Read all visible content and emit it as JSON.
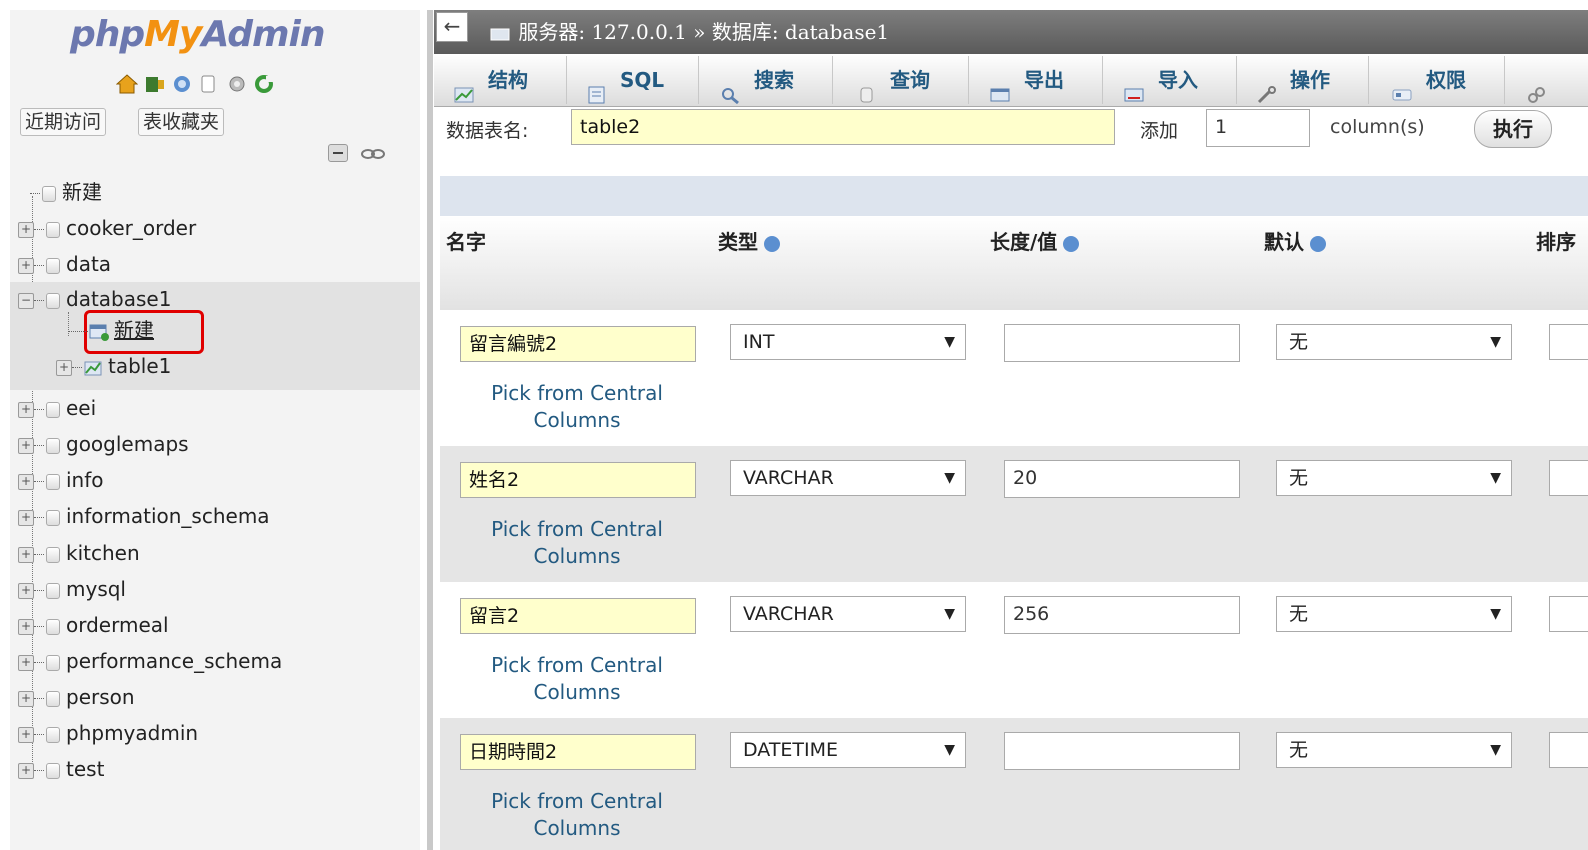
{
  "sidebar": {
    "logo": {
      "php": "php",
      "my": "My",
      "admin": "Admin"
    },
    "buttons": {
      "recent": "近期访问",
      "favorites": "表收藏夹"
    },
    "tree": [
      {
        "label": "新建"
      },
      {
        "label": "cooker_order"
      },
      {
        "label": "data"
      },
      {
        "label": "database1"
      },
      {
        "label": "新建"
      },
      {
        "label": "table1"
      },
      {
        "label": "eei"
      },
      {
        "label": "googlemaps"
      },
      {
        "label": "info"
      },
      {
        "label": "information_schema"
      },
      {
        "label": "kitchen"
      },
      {
        "label": "mysql"
      },
      {
        "label": "ordermeal"
      },
      {
        "label": "performance_schema"
      },
      {
        "label": "person"
      },
      {
        "label": "phpmyadmin"
      },
      {
        "label": "test"
      }
    ]
  },
  "topbar": {
    "back": "←",
    "breadcrumb": "服务器: 127.0.0.1 » 数据库: database1"
  },
  "tabs": [
    "结构",
    "SQL",
    "搜索",
    "查询",
    "导出",
    "导入",
    "操作",
    "权限"
  ],
  "form": {
    "table_name_label": "数据表名:",
    "table_name_value": "table2",
    "add_label": "添加",
    "add_count": "1",
    "columns_label": "column(s)",
    "execute_label": "执行"
  },
  "headers": {
    "name": "名字",
    "type": "类型",
    "length": "长度/值",
    "default": "默认",
    "collation": "排序"
  },
  "pick_line1": "Pick from Central",
  "pick_line2": "Columns",
  "rows": [
    {
      "name": "留言編號2",
      "type": "INT",
      "length": "",
      "default": "无"
    },
    {
      "name": "姓名2",
      "type": "VARCHAR",
      "length": "20",
      "default": "无"
    },
    {
      "name": "留言2",
      "type": "VARCHAR",
      "length": "256",
      "default": "无"
    },
    {
      "name": "日期時間2",
      "type": "DATETIME",
      "length": "",
      "default": "无"
    }
  ],
  "colors": {
    "accent_link": "#235a81",
    "highlight_red": "#e00000",
    "input_yellow": "#ffffcc"
  }
}
